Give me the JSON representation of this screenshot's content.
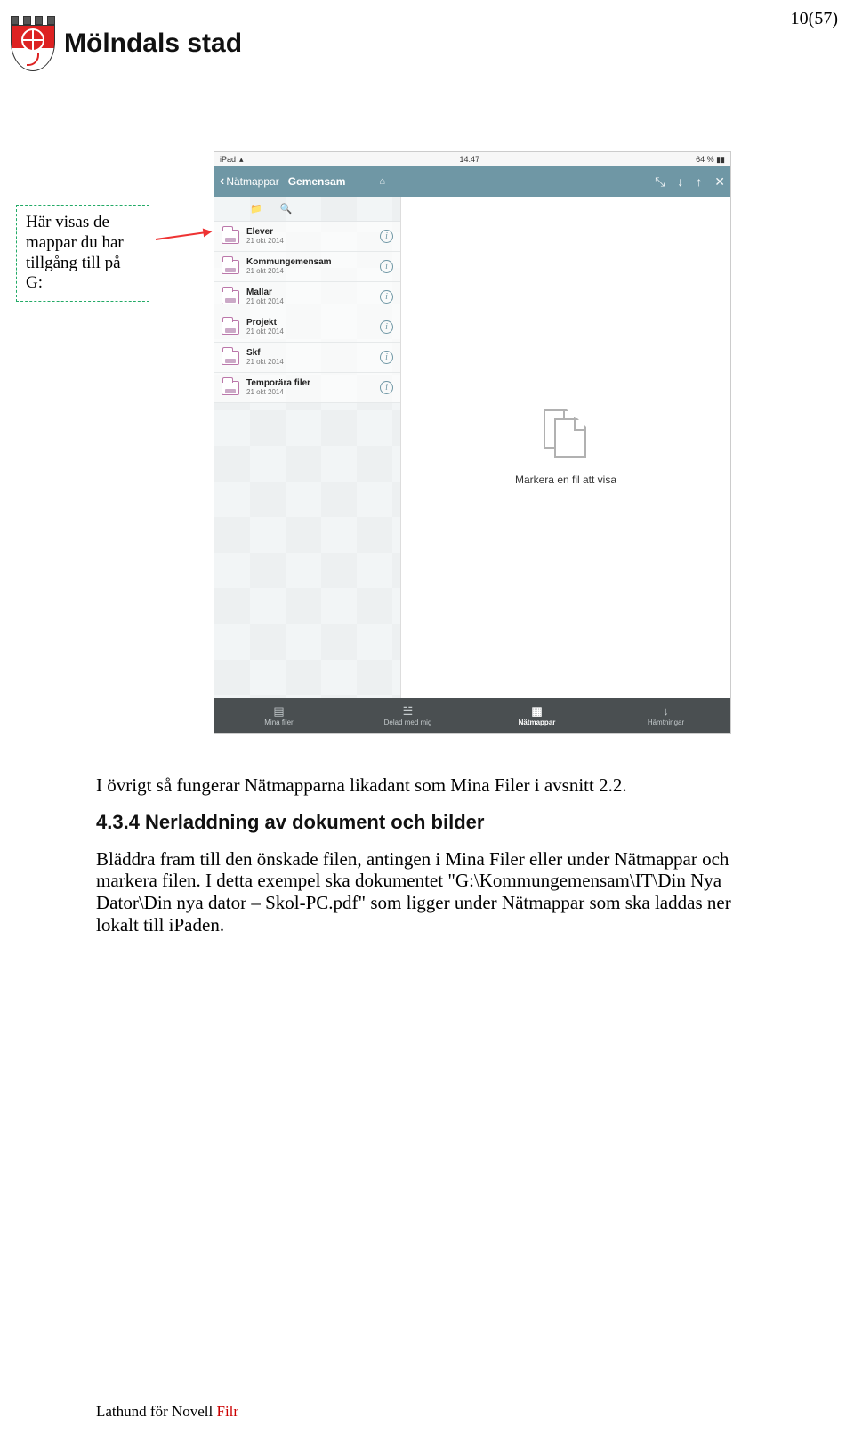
{
  "page_label": "10(57)",
  "logo_text": "Mölndals stad",
  "callout": "Här visas de mappar du har tillgång till på G:",
  "ipad": {
    "status": {
      "left": "iPad",
      "time": "14:47",
      "batt_text": "64 %"
    },
    "nav": {
      "back": "Nätmappar",
      "title": "Gemensam"
    },
    "folders": [
      {
        "name": "Elever",
        "date": "21 okt 2014"
      },
      {
        "name": "Kommungemensam",
        "date": "21 okt 2014"
      },
      {
        "name": "Mallar",
        "date": "21 okt 2014"
      },
      {
        "name": "Projekt",
        "date": "21 okt 2014"
      },
      {
        "name": "Skf",
        "date": "21 okt 2014"
      },
      {
        "name": "Temporära filer",
        "date": "21 okt 2014"
      }
    ],
    "preview_msg": "Markera en fil att visa",
    "tabs": [
      {
        "label": "Mina filer"
      },
      {
        "label": "Delad med mig"
      },
      {
        "label": "Nätmappar"
      },
      {
        "label": "Hämtningar"
      }
    ],
    "active_tab": 2
  },
  "para1": "I övrigt så fungerar Nätmapparna likadant som Mina Filer i avsnitt 2.2.",
  "section_heading": "4.3.4 Nerladdning av dokument och bilder",
  "para2": "Bläddra fram till den önskade filen, antingen i Mina Filer eller under Nätmappar och markera filen. I detta exempel ska dokumentet \"G:\\Kommungemensam\\IT\\Din Nya Dator\\Din nya dator – Skol-PC.pdf\" som ligger under Nätmappar som ska laddas ner lokalt till iPaden.",
  "footer_a": "Lathund för Novell ",
  "footer_b": "Filr"
}
